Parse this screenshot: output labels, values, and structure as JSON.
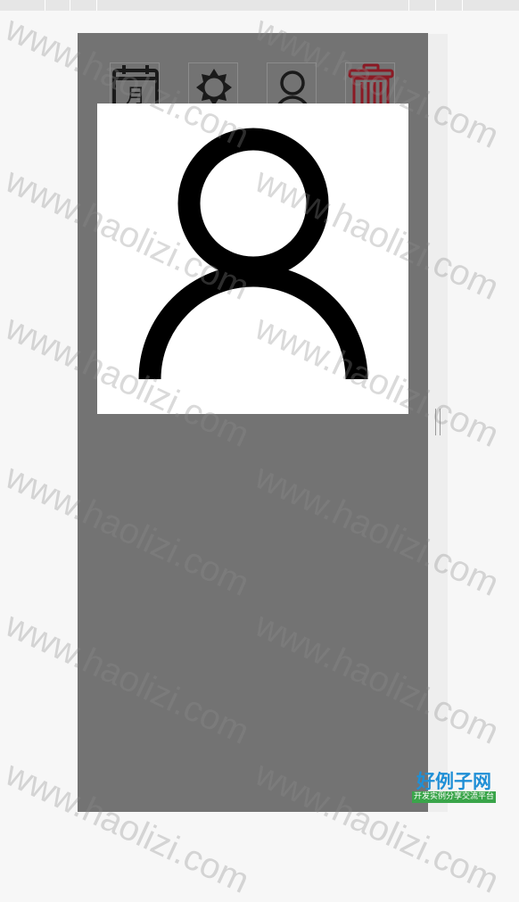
{
  "colors": {
    "panel_bg": "#737373",
    "page_bg": "#f7f7f7",
    "preview_bg": "#ffffff",
    "icon_dark": "#1a1a1a",
    "icon_delete": "#8b1a24",
    "logo_blue": "#1f8fd6",
    "logo_green": "#3aa54a"
  },
  "toolbar": {
    "buttons": [
      {
        "icon": "calendar-icon",
        "glyph": "月"
      },
      {
        "icon": "brightness-icon"
      },
      {
        "icon": "user-icon"
      },
      {
        "icon": "trash-icon"
      }
    ]
  },
  "preview": {
    "icon": "user-icon"
  },
  "watermark": {
    "text": "www.haolizi.com"
  },
  "logo": {
    "main": "好例子网",
    "sub": "开发实例分享交流平台"
  }
}
